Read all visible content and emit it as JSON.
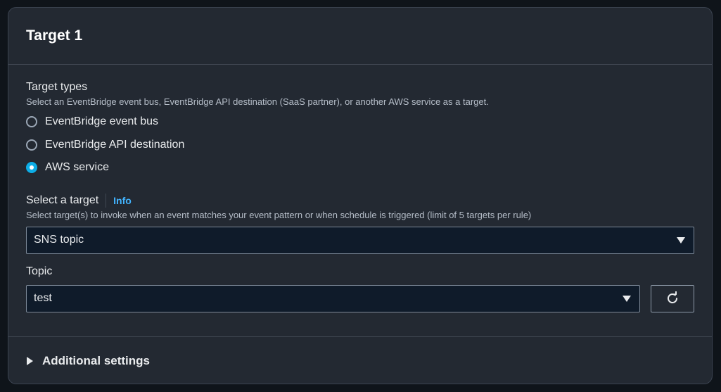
{
  "panel": {
    "title": "Target 1"
  },
  "target_types": {
    "label": "Target types",
    "description": "Select an EventBridge event bus, EventBridge API destination (SaaS partner), or another AWS service as a target.",
    "options": [
      {
        "label": "EventBridge event bus",
        "selected": false
      },
      {
        "label": "EventBridge API destination",
        "selected": false
      },
      {
        "label": "AWS service",
        "selected": true
      }
    ]
  },
  "select_target": {
    "label": "Select a target",
    "info_link": "Info",
    "description": "Select target(s) to invoke when an event matches your event pattern or when schedule is triggered (limit of 5 targets per rule)",
    "value": "SNS topic"
  },
  "topic": {
    "label": "Topic",
    "value": "test"
  },
  "additional_settings": {
    "label": "Additional settings"
  },
  "colors": {
    "panel_bg": "#232932",
    "accent": "#0dade6",
    "link": "#42b4ff",
    "input_bg": "#0f1b2a"
  }
}
